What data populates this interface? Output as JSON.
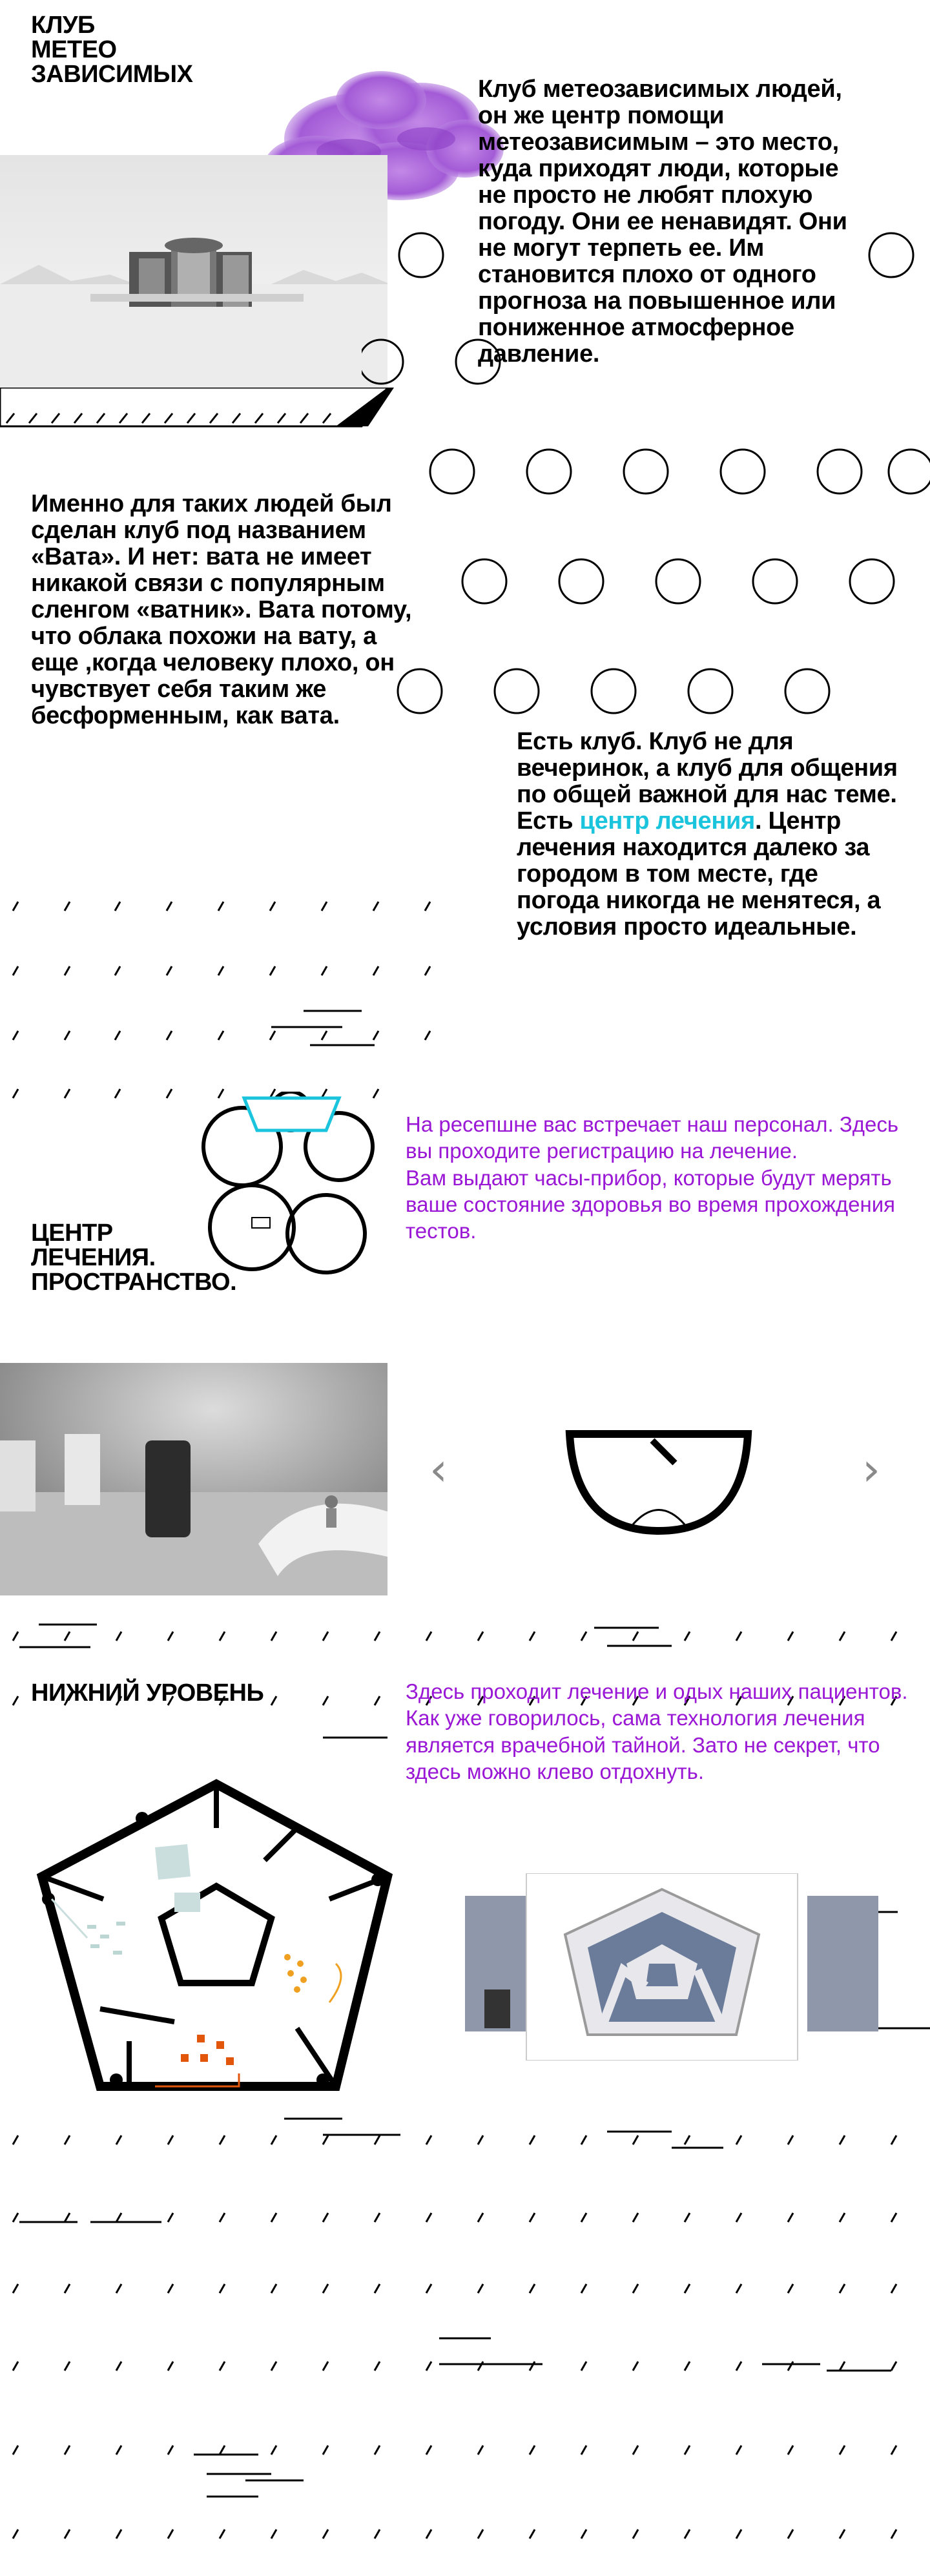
{
  "title": [
    "КЛУБ",
    "МЕТЕО",
    "ЗАВИСИМЫХ"
  ],
  "intro": "Клуб метеозависимых людей, он же центр помощи метеозависимым – это место, куда приходят люди, которые не просто не любят плохую погоду. Они ее ненавидят. Они не могут терпеть ее. Им становится плохо от одного прогноза на повышенное или пониженное атмосферное давление.",
  "vata": "Именно для таких людей был сделан клуб под названием «Вата». И нет: вата не имеет никакой связи с популярным сленгом «ватник». Вата потому, что облака похожи на вату, а еще ,когда человеку плохо, он чувствует себя таким же бесформенным, как вата.",
  "club": {
    "before": "Есть клуб. Клуб не для вечеринок, а клуб для общения по общей важной для нас теме. Есть ",
    "link": "центр лечения",
    "after": ". Центр лечения находится далеко за городом в том месте, где погода никогда не менятеся, а условия просто идеальные."
  },
  "center_heading": [
    "ЦЕНТР",
    "ЛЕЧЕНИЯ.",
    "ПРОСТРАНСТВО."
  ],
  "reception": "На ресепшне вас встречает наш персонал. Здесь вы проходите регистрацию на лечение.\nВам выдают часы-прибор, которые будут мерять ваше состояние здоровья во время прохождения тестов.",
  "carousel": {
    "prev": "‹",
    "next": "›"
  },
  "lower_heading": "НИЖНИЙ УРОВЕНЬ",
  "lower_text": "Здесь проходит лечение и одых наших пациентов. Как уже говорилось, сама технология лечения является врачебной тайной. Зато не секрет, что здесь можно клево отдохнуть.",
  "colors": {
    "accent": "#19c4dc",
    "purple_text": "#9a17d6",
    "cloud": "#a35bd6"
  },
  "icons": [
    "cloud-image",
    "building-render",
    "circle-pattern",
    "slash-pattern",
    "floor-plan-top",
    "reception-render",
    "half-circle-plan",
    "pentagon-floor-plan",
    "pentagon-model-render"
  ]
}
